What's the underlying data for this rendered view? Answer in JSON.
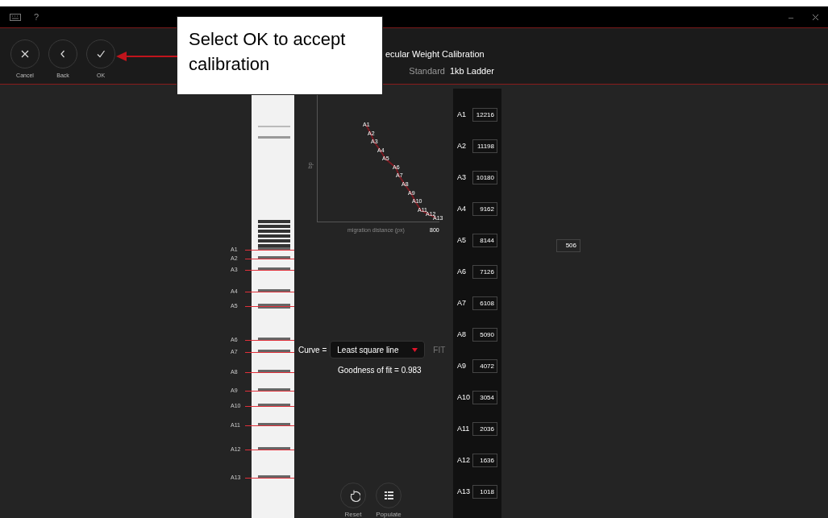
{
  "title_bar": {
    "help": "?",
    "minimize": "–"
  },
  "toolbar": [
    {
      "kind": "cancel",
      "label": "Cancel"
    },
    {
      "kind": "back",
      "label": "Back"
    },
    {
      "kind": "ok",
      "label": "OK"
    }
  ],
  "header": {
    "title": "ecular Weight Calibration",
    "standard_label": "Standard",
    "standard_value": "1kb Ladder"
  },
  "callout": {
    "text": "Select OK to accept calibration"
  },
  "gel": {
    "bands": [
      "A1",
      "A2",
      "A3",
      "A4",
      "A5",
      "A6",
      "A7",
      "A8",
      "A9",
      "A10",
      "A11",
      "A12",
      "A13"
    ]
  },
  "chart": {
    "ylabel": "bp",
    "xlabel": "migration distance (px)",
    "x_max": "800",
    "points": [
      "A1",
      "A2",
      "A3",
      "A4",
      "A5",
      "A6",
      "A7",
      "A8",
      "A9",
      "A10",
      "A11",
      "A12",
      "A13"
    ]
  },
  "curve": {
    "label": "Curve =",
    "value": "Least square line",
    "fit": "FIT",
    "goodness": "Goodness of fit = 0.983"
  },
  "actions": [
    {
      "kind": "reset",
      "label": "Reset"
    },
    {
      "kind": "populate",
      "label": "Populate"
    }
  ],
  "standards": [
    {
      "label": "A1",
      "value": "12216"
    },
    {
      "label": "A2",
      "value": "11198"
    },
    {
      "label": "A3",
      "value": "10180"
    },
    {
      "label": "A4",
      "value": "9162"
    },
    {
      "label": "A5",
      "value": "8144"
    },
    {
      "label": "A6",
      "value": "7126"
    },
    {
      "label": "A7",
      "value": "6108"
    },
    {
      "label": "A8",
      "value": "5090"
    },
    {
      "label": "A9",
      "value": "4072"
    },
    {
      "label": "A10",
      "value": "3054"
    },
    {
      "label": "A11",
      "value": "2036"
    },
    {
      "label": "A12",
      "value": "1636"
    },
    {
      "label": "A13",
      "value": "1018"
    }
  ],
  "extra_field": {
    "value": "506"
  }
}
